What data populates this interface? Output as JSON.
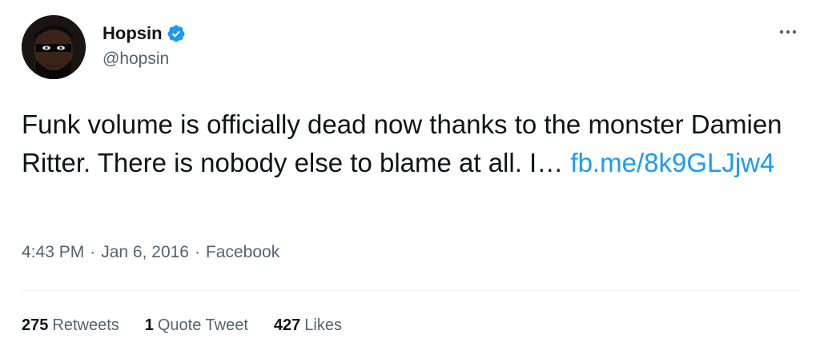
{
  "author": {
    "display_name": "Hopsin",
    "handle": "@hopsin",
    "verified": true,
    "avatar_icon": "avatar-masked-face"
  },
  "more_icon": "ellipsis-icon",
  "tweet": {
    "text": "Funk volume is officially dead now thanks to the monster Damien Ritter. There is nobody else to blame at all. I…",
    "link_text": "fb.me/8k9GLJjw4"
  },
  "meta": {
    "time": "4:43 PM",
    "separator": "·",
    "date": "Jan 6, 2016",
    "source": "Facebook"
  },
  "stats": {
    "retweets": {
      "count": "275",
      "label": "Retweets"
    },
    "quote_tweets": {
      "count": "1",
      "label": "Quote Tweet"
    },
    "likes": {
      "count": "427",
      "label": "Likes"
    }
  },
  "colors": {
    "text": "#0f1419",
    "secondary": "#536471",
    "link": "#1d9bf0",
    "verified": "#1d9bf0",
    "divider": "#eff3f4"
  }
}
